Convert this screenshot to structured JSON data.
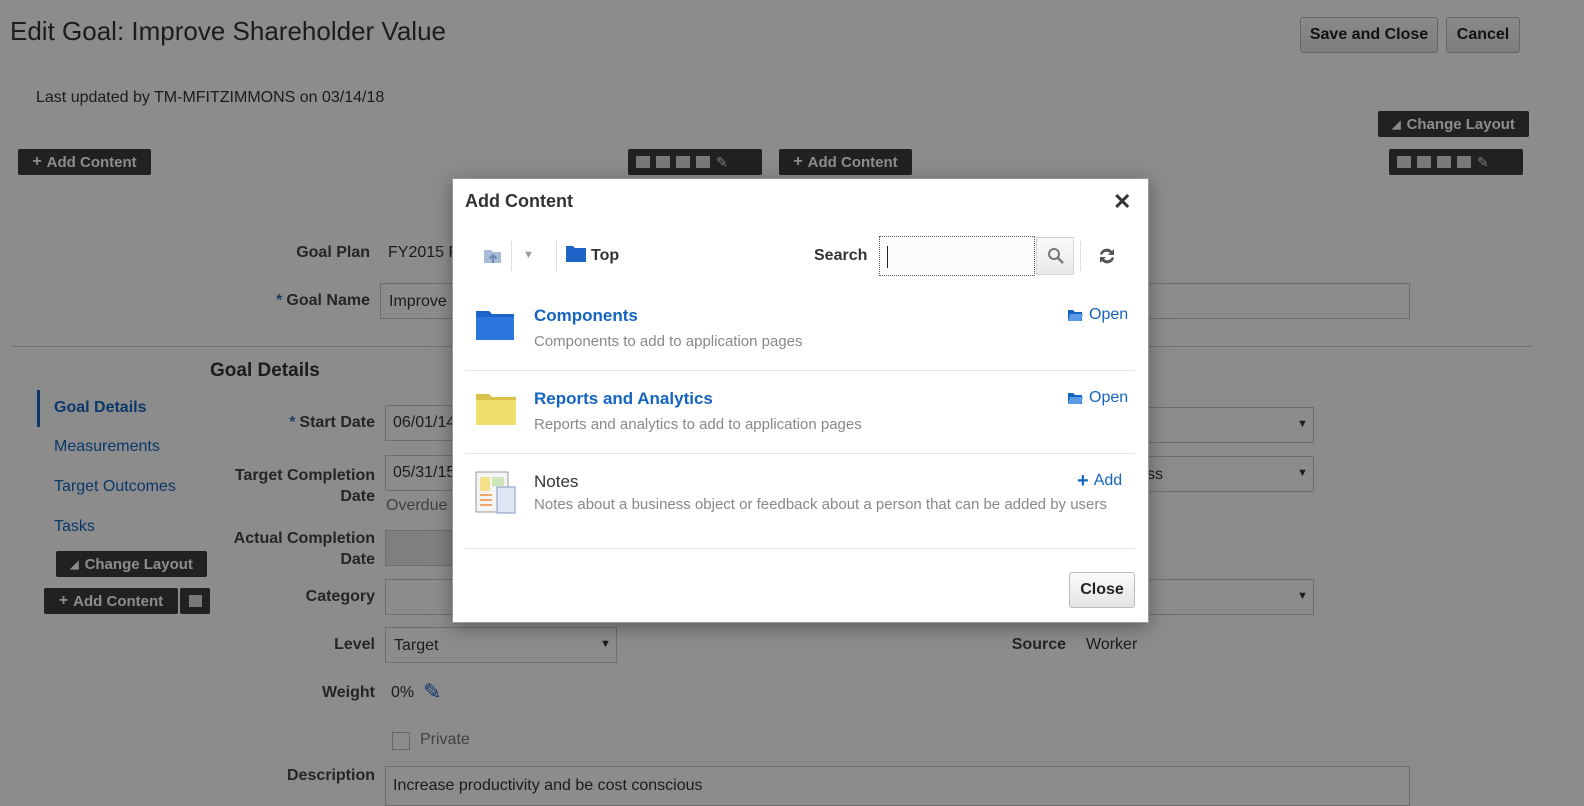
{
  "page": {
    "title": "Edit Goal: Improve Shareholder Value",
    "save_close": "Save and Close",
    "cancel": "Cancel",
    "last_updated": "Last updated by TM-MFITZIMMONS on 03/14/18",
    "change_layout": "Change Layout",
    "add_content": "Add Content"
  },
  "form": {
    "goal_plan_label": "Goal Plan",
    "goal_plan_value": "FY2015 F",
    "goal_name_label": "Goal Name",
    "goal_name_value": "Improve S",
    "section_title": "Goal Details",
    "start_date_label": "Start Date",
    "start_date_value": "06/01/14",
    "target_completion_label_1": "Target Completion",
    "target_completion_label_2": "Date",
    "target_completion_value": "05/31/15",
    "overdue": "Overdue",
    "actual_completion_label_1": "Actual Completion",
    "actual_completion_label_2": "Date",
    "category_label": "Category",
    "level_label": "Level",
    "level_value": "Target",
    "weight_label": "Weight",
    "weight_value": "0%",
    "private_label": "Private",
    "description_label": "Description",
    "description_value": "Increase productivity and be cost conscious",
    "source_label": "Source",
    "source_value": "Worker",
    "right_partial": "ss"
  },
  "nav": {
    "items": [
      "Goal Details",
      "Measurements",
      "Target Outcomes",
      "Tasks"
    ]
  },
  "dialog": {
    "title": "Add Content",
    "breadcrumb": "Top",
    "search_label": "Search",
    "search_value": "",
    "close_button": "Close",
    "items": [
      {
        "title": "Components",
        "desc": "Components to add to application pages",
        "action": "Open"
      },
      {
        "title": "Reports and Analytics",
        "desc": "Reports and analytics to add to application pages",
        "action": "Open"
      },
      {
        "title": "Notes",
        "desc": "Notes about a business object or feedback about a person that can be added by users",
        "action": "Add"
      }
    ]
  },
  "colors": {
    "link": "#1565c0",
    "folder_blue": "#1e64c8",
    "folder_yellow": "#f0de6a",
    "dark_button": "#3c3c3c"
  }
}
